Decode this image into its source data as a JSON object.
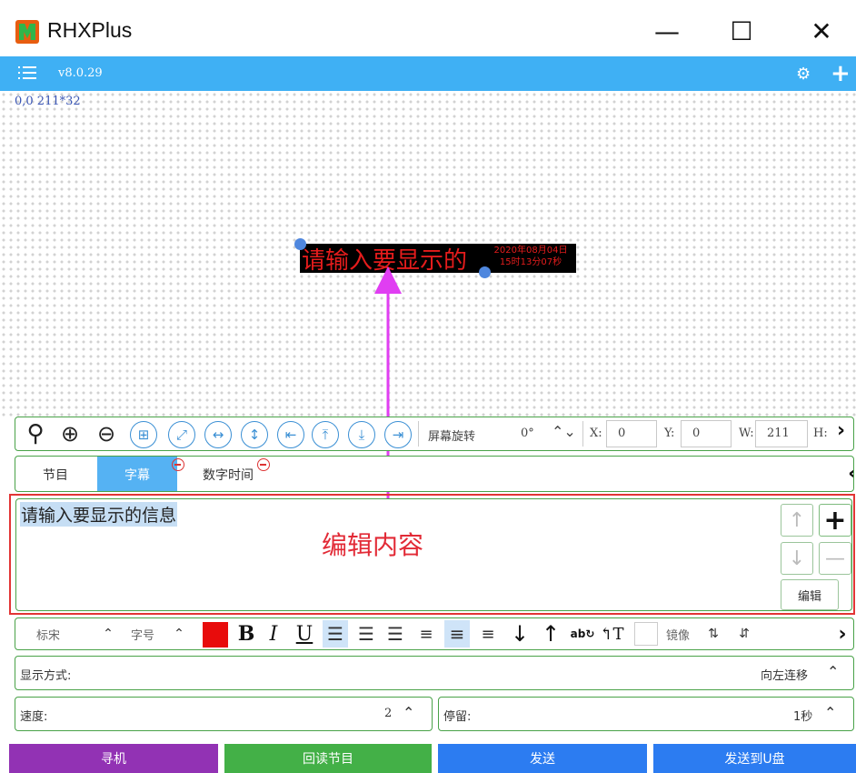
{
  "titlebar": {
    "app_name": "RHXPlus",
    "minimize_glyph": "—",
    "maximize_glyph": "☐",
    "close_glyph": "✕"
  },
  "appbar": {
    "version": "v8.0.29",
    "color": "#3fb0f4"
  },
  "canvas": {
    "coords": "0,0 211*32",
    "led_text": "请输入要显示的",
    "led_date_line1": "2020年08月04日",
    "led_date_line2": "15时13分07秒"
  },
  "toolbar": {
    "rotate_label": "屏幕旋转",
    "rotate_value": "0°",
    "x_label": "X:",
    "x_value": "0",
    "y_label": "Y:",
    "y_value": "0",
    "w_label": "W:",
    "w_value": "211",
    "h_label": "H:",
    "icons": [
      "search-icon",
      "zoom-in-icon",
      "zoom-out-icon",
      "grid-icon",
      "fit-screen-icon",
      "horizontal-expand-icon",
      "vertical-expand-icon",
      "align-left-icon",
      "align-top-icon",
      "align-bottom-icon",
      "align-right-icon"
    ]
  },
  "tabs": [
    {
      "label": "节目",
      "active": false
    },
    {
      "label": "字幕",
      "active": true
    },
    {
      "label": "数字时间",
      "active": false
    }
  ],
  "editor": {
    "content": "请输入要显示的信息",
    "annotation": "编辑内容",
    "edit_label": "编辑"
  },
  "format": {
    "font": "标宋",
    "size_label": "字号",
    "color": "#e80c0c",
    "bold": "B",
    "italic": "I",
    "underline": "U",
    "mirror_label": "镜像"
  },
  "display_mode": {
    "label": "显示方式:",
    "value": "向左连移"
  },
  "speed": {
    "label": "速度:",
    "value": "2"
  },
  "stay": {
    "label": "停留:",
    "value": "1秒"
  },
  "bottom_buttons": [
    {
      "label": "寻机",
      "color": "#9232b4"
    },
    {
      "label": "回读节目",
      "color": "#43b047"
    },
    {
      "label": "发送",
      "color": "#2c7cf1"
    },
    {
      "label": "发送到U盘",
      "color": "#2c7cf1"
    }
  ]
}
